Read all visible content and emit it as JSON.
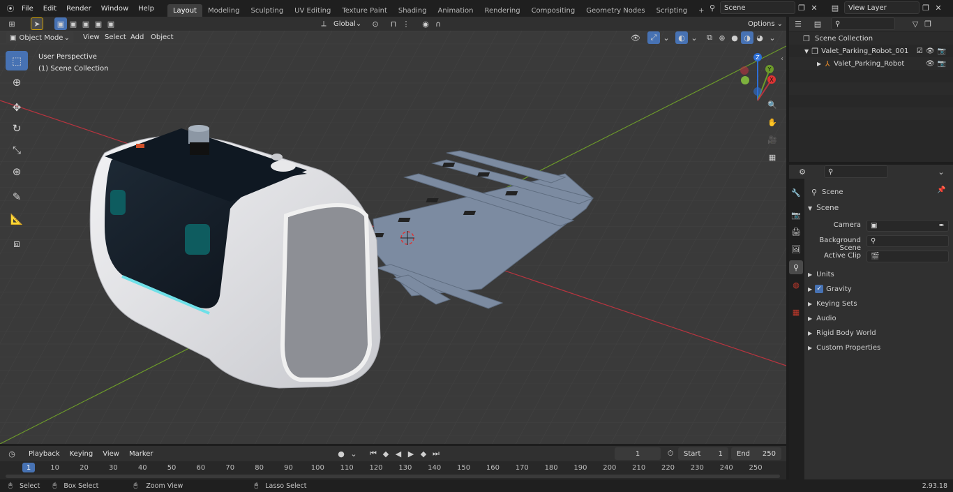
{
  "topbar": {
    "menus": [
      "File",
      "Edit",
      "Render",
      "Window",
      "Help"
    ],
    "workspaces": [
      "Layout",
      "Modeling",
      "Sculpting",
      "UV Editing",
      "Texture Paint",
      "Shading",
      "Animation",
      "Rendering",
      "Compositing",
      "Geometry Nodes",
      "Scripting"
    ],
    "active_workspace": "Layout",
    "scene_name": "Scene",
    "view_layer": "View Layer",
    "add_tab": "+"
  },
  "viewport_header": {
    "mode": "Object Mode",
    "menus": [
      "View",
      "Select",
      "Add",
      "Object"
    ],
    "transform_orientation": "Global",
    "options": "Options"
  },
  "viewport": {
    "perspective_label": "User Perspective",
    "collection_label": "(1) Scene Collection",
    "gizmo": {
      "z": "Z",
      "y": "Y",
      "x": "X"
    }
  },
  "outliner": {
    "root": "Scene Collection",
    "items": [
      {
        "label": "Valet_Parking_Robot_001"
      },
      {
        "label": "Valet_Parking_Robot"
      }
    ]
  },
  "properties": {
    "context": "Scene",
    "section": "Scene",
    "fields": [
      {
        "label": "Camera",
        "value": ""
      },
      {
        "label": "Background Scene",
        "value": ""
      },
      {
        "label": "Active Clip",
        "value": ""
      }
    ],
    "panels": [
      "Units",
      "Gravity",
      "Keying Sets",
      "Audio",
      "Rigid Body World",
      "Custom Properties"
    ],
    "gravity_checked": true
  },
  "timeline": {
    "menus": [
      "Playback",
      "Keying",
      "View",
      "Marker"
    ],
    "current_frame": "1",
    "start_label": "Start",
    "start_value": "1",
    "end_label": "End",
    "end_value": "250",
    "ruler_ticks": [
      "1",
      "10",
      "20",
      "30",
      "40",
      "50",
      "60",
      "70",
      "80",
      "90",
      "100",
      "110",
      "120",
      "130",
      "140",
      "150",
      "160",
      "170",
      "180",
      "190",
      "200",
      "210",
      "220",
      "230",
      "240",
      "250"
    ]
  },
  "statusbar": {
    "select": "Select",
    "box_select": "Box Select",
    "zoom_view": "Zoom View",
    "lasso_select": "Lasso Select",
    "version": "2.93.18"
  },
  "colors": {
    "accent": "#4772b3",
    "x_axis": "#b8343f",
    "y_axis": "#6c9a2a",
    "z_axis": "#2d6fd6",
    "viewport_bg": "#3a3a3a"
  }
}
